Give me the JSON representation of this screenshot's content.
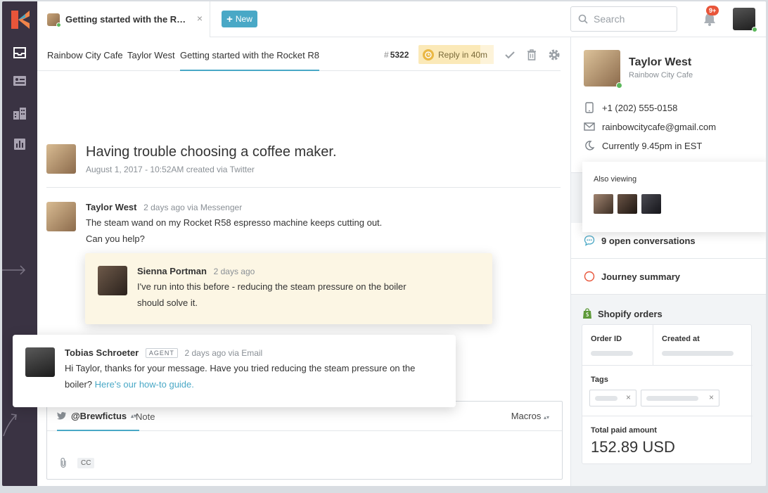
{
  "colors": {
    "accent": "#49a8c6",
    "rail": "#3a3343",
    "online": "#5cb85c",
    "badge": "#e8553a",
    "reply_bg": "#fbe9b8"
  },
  "tab": {
    "title": "Getting started with the R…",
    "close": "×"
  },
  "toolbar": {
    "new_label": "New",
    "search_placeholder": "Search",
    "notif_badge": "9+"
  },
  "breadcrumbs": [
    "Rainbow City Cafe",
    "Taylor West",
    "Getting started with the Rocket R8"
  ],
  "ticket": {
    "hash": "#",
    "number": "5322",
    "reply_label": "Reply in 40m",
    "reply_progress": 0.82
  },
  "conversation": {
    "subject": "Having trouble choosing a coffee maker.",
    "subject_meta": "August 1, 2017 - 10:52AM created via Twitter",
    "messages": [
      {
        "author": "Taylor West",
        "time": "2 days ago via Messenger",
        "line1": "The steam wand on my Rocket R58 espresso machine keeps cutting out.",
        "line2": "Can you help?"
      },
      {
        "author": "Sienna Portman",
        "time": "2 days ago",
        "line1": "I've run into this before - reducing the steam pressure on the boiler",
        "line2": "should solve it."
      },
      {
        "author": "Tobias Schroeter",
        "tag": "AGENT",
        "time": "2 days ago via Email",
        "line1": "Hi Taylor, thanks for your message. Have you tried reducing the steam pressure on the",
        "line2": "boiler?",
        "link": "Here's our how-to guide."
      }
    ]
  },
  "composer": {
    "channel": "@Brewfictus",
    "channel_arrow": "⌃",
    "note": "Note",
    "macros": "Macros",
    "cc": "CC"
  },
  "sidebar": {
    "name": "Taylor West",
    "company": "Rainbow City Cafe",
    "phone": "+1 (202) 555-0158",
    "email": "rainbowcitycafe@gmail.com",
    "local_time": "Currently 9.45pm in EST",
    "also_viewing": "Also viewing",
    "open_conversations": "9 open conversations",
    "journey": "Journey summary",
    "shopify": {
      "title": "Shopify orders",
      "order_id": "Order ID",
      "created_at": "Created at",
      "tags": "Tags",
      "total_label": "Total paid amount",
      "total_value": "152.89 USD"
    }
  }
}
